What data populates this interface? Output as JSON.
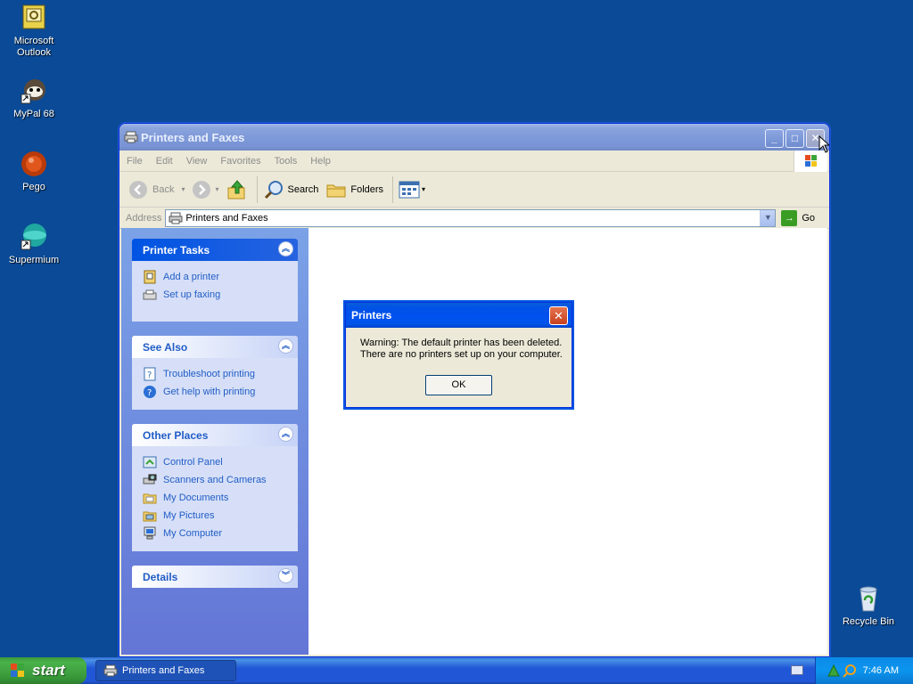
{
  "desktop": {
    "icons": [
      {
        "label_line1": "Microsoft",
        "label_line2": "Outlook"
      },
      {
        "label_line1": "MyPal 68",
        "label_line2": ""
      },
      {
        "label_line1": "Pego",
        "label_line2": ""
      },
      {
        "label_line1": "Supermium",
        "label_line2": ""
      },
      {
        "label_line1": "Recycle Bin",
        "label_line2": ""
      }
    ]
  },
  "window": {
    "title": "Printers and Faxes",
    "menu": [
      "File",
      "Edit",
      "View",
      "Favorites",
      "Tools",
      "Help"
    ],
    "toolbar": {
      "back": "Back",
      "search": "Search",
      "folders": "Folders"
    },
    "address": {
      "label": "Address",
      "value": "Printers and Faxes",
      "go": "Go"
    },
    "taskpane": {
      "printer_tasks": {
        "title": "Printer Tasks",
        "items": [
          "Add a printer",
          "Set up faxing"
        ]
      },
      "see_also": {
        "title": "See Also",
        "items": [
          "Troubleshoot printing",
          "Get help with printing"
        ]
      },
      "other_places": {
        "title": "Other Places",
        "items": [
          "Control Panel",
          "Scanners and Cameras",
          "My Documents",
          "My Pictures",
          "My Computer"
        ]
      },
      "details": {
        "title": "Details"
      }
    }
  },
  "dialog": {
    "title": "Printers",
    "line1": "Warning: The default printer has been deleted.",
    "line2": "There are no printers set up on your computer.",
    "ok": "OK"
  },
  "taskbar": {
    "start": "start",
    "task": "Printers and Faxes",
    "clock": "7:46 AM"
  },
  "colors": {
    "desktop": "#0a4a96",
    "link": "#215dc6",
    "taskbar": "#2157d7",
    "start_green": "#3c9a3c"
  }
}
